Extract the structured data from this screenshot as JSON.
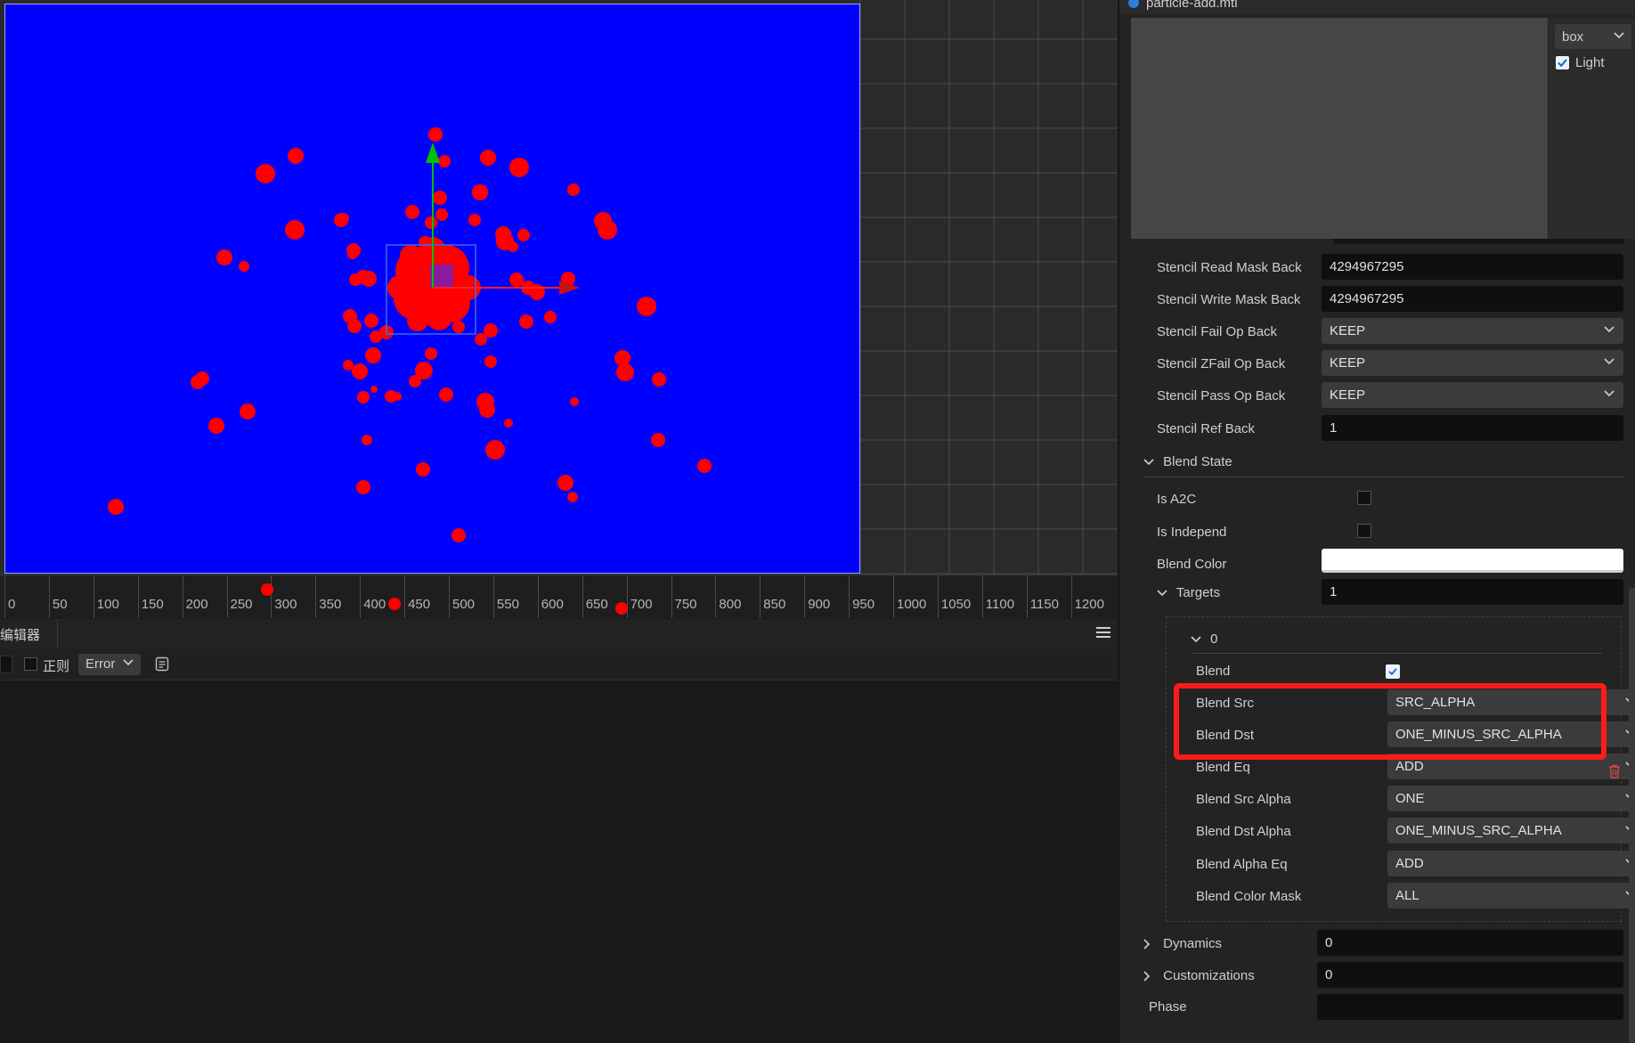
{
  "scene": {
    "canvas_color": "#0000ff",
    "particle_color": "#ff0000",
    "ruler_labels": [
      "0",
      "50",
      "100",
      "150",
      "200",
      "250",
      "300",
      "350",
      "400",
      "450",
      "500",
      "550",
      "600",
      "650",
      "700",
      "750",
      "800",
      "850",
      "900",
      "950",
      "1000",
      "1050",
      "1100",
      "1150",
      "1200"
    ]
  },
  "console": {
    "title": "编辑器",
    "regex_label": "正则",
    "level_value": "Error"
  },
  "inspector": {
    "file_name": "particle-add.mtl",
    "mesh_value": "box",
    "light_label": "Light",
    "light_checked": true,
    "stencil_rows": [
      {
        "label": "Stencil Read Mask Back",
        "value": "4294967295",
        "kind": "input"
      },
      {
        "label": "Stencil Write Mask Back",
        "value": "4294967295",
        "kind": "input"
      },
      {
        "label": "Stencil Fail Op Back",
        "value": "KEEP",
        "kind": "select"
      },
      {
        "label": "Stencil ZFail Op Back",
        "value": "KEEP",
        "kind": "select"
      },
      {
        "label": "Stencil Pass Op Back",
        "value": "KEEP",
        "kind": "select"
      },
      {
        "label": "Stencil Ref Back",
        "value": "1",
        "kind": "input"
      }
    ],
    "blend_state": {
      "title": "Blend State",
      "is_a2c_label": "Is A2C",
      "is_a2c": false,
      "is_independ_label": "Is Independ",
      "is_independ": false,
      "blend_color_label": "Blend Color",
      "blend_color": "#ffffff",
      "targets_label": "Targets",
      "targets_count": "1",
      "target_index": "0",
      "blend_label": "Blend",
      "blend_checked": true,
      "target_rows": [
        {
          "label": "Blend Src",
          "value": "SRC_ALPHA"
        },
        {
          "label": "Blend Dst",
          "value": "ONE_MINUS_SRC_ALPHA"
        },
        {
          "label": "Blend Eq",
          "value": "ADD"
        },
        {
          "label": "Blend Src Alpha",
          "value": "ONE"
        },
        {
          "label": "Blend Dst Alpha",
          "value": "ONE_MINUS_SRC_ALPHA"
        },
        {
          "label": "Blend Alpha Eq",
          "value": "ADD"
        },
        {
          "label": "Blend Color Mask",
          "value": "ALL"
        }
      ]
    },
    "dynamics_label": "Dynamics",
    "dynamics_value": "0",
    "customizations_label": "Customizations",
    "customizations_value": "0",
    "phase_label": "Phase",
    "phase_value": ""
  },
  "colors": {
    "highlight": "#ff1a1a",
    "gizmo_y": "#00c000",
    "gizmo_x": "#ff2020"
  }
}
